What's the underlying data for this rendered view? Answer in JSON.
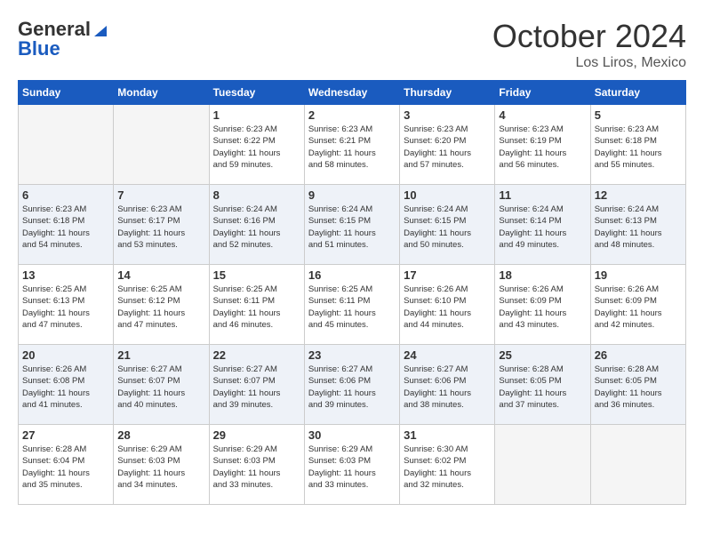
{
  "header": {
    "logo_general": "General",
    "logo_blue": "Blue",
    "month_title": "October 2024",
    "location": "Los Liros, Mexico"
  },
  "days_of_week": [
    "Sunday",
    "Monday",
    "Tuesday",
    "Wednesday",
    "Thursday",
    "Friday",
    "Saturday"
  ],
  "weeks": [
    [
      {
        "num": "",
        "info": "",
        "empty": true
      },
      {
        "num": "",
        "info": "",
        "empty": true
      },
      {
        "num": "1",
        "info": "Sunrise: 6:23 AM\nSunset: 6:22 PM\nDaylight: 11 hours\nand 59 minutes.",
        "empty": false
      },
      {
        "num": "2",
        "info": "Sunrise: 6:23 AM\nSunset: 6:21 PM\nDaylight: 11 hours\nand 58 minutes.",
        "empty": false
      },
      {
        "num": "3",
        "info": "Sunrise: 6:23 AM\nSunset: 6:20 PM\nDaylight: 11 hours\nand 57 minutes.",
        "empty": false
      },
      {
        "num": "4",
        "info": "Sunrise: 6:23 AM\nSunset: 6:19 PM\nDaylight: 11 hours\nand 56 minutes.",
        "empty": false
      },
      {
        "num": "5",
        "info": "Sunrise: 6:23 AM\nSunset: 6:18 PM\nDaylight: 11 hours\nand 55 minutes.",
        "empty": false
      }
    ],
    [
      {
        "num": "6",
        "info": "Sunrise: 6:23 AM\nSunset: 6:18 PM\nDaylight: 11 hours\nand 54 minutes.",
        "empty": false
      },
      {
        "num": "7",
        "info": "Sunrise: 6:23 AM\nSunset: 6:17 PM\nDaylight: 11 hours\nand 53 minutes.",
        "empty": false
      },
      {
        "num": "8",
        "info": "Sunrise: 6:24 AM\nSunset: 6:16 PM\nDaylight: 11 hours\nand 52 minutes.",
        "empty": false
      },
      {
        "num": "9",
        "info": "Sunrise: 6:24 AM\nSunset: 6:15 PM\nDaylight: 11 hours\nand 51 minutes.",
        "empty": false
      },
      {
        "num": "10",
        "info": "Sunrise: 6:24 AM\nSunset: 6:15 PM\nDaylight: 11 hours\nand 50 minutes.",
        "empty": false
      },
      {
        "num": "11",
        "info": "Sunrise: 6:24 AM\nSunset: 6:14 PM\nDaylight: 11 hours\nand 49 minutes.",
        "empty": false
      },
      {
        "num": "12",
        "info": "Sunrise: 6:24 AM\nSunset: 6:13 PM\nDaylight: 11 hours\nand 48 minutes.",
        "empty": false
      }
    ],
    [
      {
        "num": "13",
        "info": "Sunrise: 6:25 AM\nSunset: 6:13 PM\nDaylight: 11 hours\nand 47 minutes.",
        "empty": false
      },
      {
        "num": "14",
        "info": "Sunrise: 6:25 AM\nSunset: 6:12 PM\nDaylight: 11 hours\nand 47 minutes.",
        "empty": false
      },
      {
        "num": "15",
        "info": "Sunrise: 6:25 AM\nSunset: 6:11 PM\nDaylight: 11 hours\nand 46 minutes.",
        "empty": false
      },
      {
        "num": "16",
        "info": "Sunrise: 6:25 AM\nSunset: 6:11 PM\nDaylight: 11 hours\nand 45 minutes.",
        "empty": false
      },
      {
        "num": "17",
        "info": "Sunrise: 6:26 AM\nSunset: 6:10 PM\nDaylight: 11 hours\nand 44 minutes.",
        "empty": false
      },
      {
        "num": "18",
        "info": "Sunrise: 6:26 AM\nSunset: 6:09 PM\nDaylight: 11 hours\nand 43 minutes.",
        "empty": false
      },
      {
        "num": "19",
        "info": "Sunrise: 6:26 AM\nSunset: 6:09 PM\nDaylight: 11 hours\nand 42 minutes.",
        "empty": false
      }
    ],
    [
      {
        "num": "20",
        "info": "Sunrise: 6:26 AM\nSunset: 6:08 PM\nDaylight: 11 hours\nand 41 minutes.",
        "empty": false
      },
      {
        "num": "21",
        "info": "Sunrise: 6:27 AM\nSunset: 6:07 PM\nDaylight: 11 hours\nand 40 minutes.",
        "empty": false
      },
      {
        "num": "22",
        "info": "Sunrise: 6:27 AM\nSunset: 6:07 PM\nDaylight: 11 hours\nand 39 minutes.",
        "empty": false
      },
      {
        "num": "23",
        "info": "Sunrise: 6:27 AM\nSunset: 6:06 PM\nDaylight: 11 hours\nand 39 minutes.",
        "empty": false
      },
      {
        "num": "24",
        "info": "Sunrise: 6:27 AM\nSunset: 6:06 PM\nDaylight: 11 hours\nand 38 minutes.",
        "empty": false
      },
      {
        "num": "25",
        "info": "Sunrise: 6:28 AM\nSunset: 6:05 PM\nDaylight: 11 hours\nand 37 minutes.",
        "empty": false
      },
      {
        "num": "26",
        "info": "Sunrise: 6:28 AM\nSunset: 6:05 PM\nDaylight: 11 hours\nand 36 minutes.",
        "empty": false
      }
    ],
    [
      {
        "num": "27",
        "info": "Sunrise: 6:28 AM\nSunset: 6:04 PM\nDaylight: 11 hours\nand 35 minutes.",
        "empty": false
      },
      {
        "num": "28",
        "info": "Sunrise: 6:29 AM\nSunset: 6:03 PM\nDaylight: 11 hours\nand 34 minutes.",
        "empty": false
      },
      {
        "num": "29",
        "info": "Sunrise: 6:29 AM\nSunset: 6:03 PM\nDaylight: 11 hours\nand 33 minutes.",
        "empty": false
      },
      {
        "num": "30",
        "info": "Sunrise: 6:29 AM\nSunset: 6:03 PM\nDaylight: 11 hours\nand 33 minutes.",
        "empty": false
      },
      {
        "num": "31",
        "info": "Sunrise: 6:30 AM\nSunset: 6:02 PM\nDaylight: 11 hours\nand 32 minutes.",
        "empty": false
      },
      {
        "num": "",
        "info": "",
        "empty": true
      },
      {
        "num": "",
        "info": "",
        "empty": true
      }
    ]
  ]
}
